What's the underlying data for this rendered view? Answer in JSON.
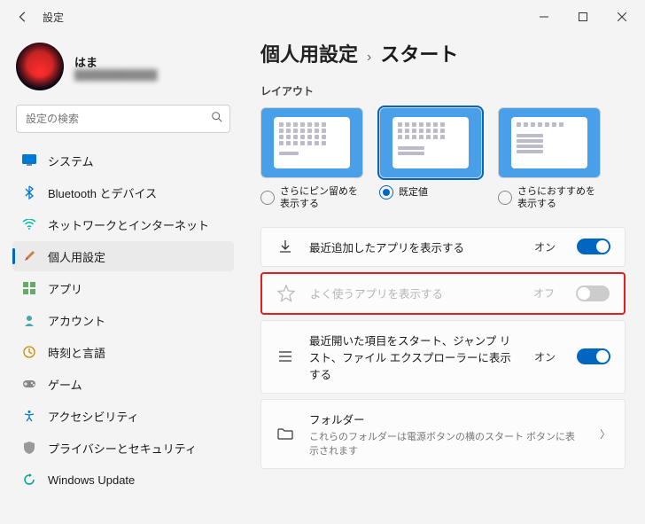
{
  "titlebar": {
    "title": "設定"
  },
  "profile": {
    "name": "はま",
    "meta": "████████████"
  },
  "search": {
    "placeholder": "設定の検索"
  },
  "sidebar": {
    "items": [
      {
        "label": "システム"
      },
      {
        "label": "Bluetooth とデバイス"
      },
      {
        "label": "ネットワークとインターネット"
      },
      {
        "label": "個人用設定"
      },
      {
        "label": "アプリ"
      },
      {
        "label": "アカウント"
      },
      {
        "label": "時刻と言語"
      },
      {
        "label": "ゲーム"
      },
      {
        "label": "アクセシビリティ"
      },
      {
        "label": "プライバシーとセキュリティ"
      },
      {
        "label": "Windows Update"
      }
    ]
  },
  "main": {
    "crumb1": "個人用設定",
    "crumb2": "スタート",
    "section_layout": "レイアウト",
    "layouts": [
      {
        "label": "さらにピン留めを表示する"
      },
      {
        "label": "既定値"
      },
      {
        "label": "さらにおすすめを表示する"
      }
    ],
    "settings": [
      {
        "title": "最近追加したアプリを表示する",
        "state": "オン"
      },
      {
        "title": "よく使うアプリを表示する",
        "state": "オフ"
      },
      {
        "title": "最近開いた項目をスタート、ジャンプ リスト、ファイル エクスプローラーに表示する",
        "state": "オン"
      },
      {
        "title": "フォルダー",
        "sub": "これらのフォルダーは電源ボタンの横のスタート ボタンに表示されます"
      }
    ]
  }
}
